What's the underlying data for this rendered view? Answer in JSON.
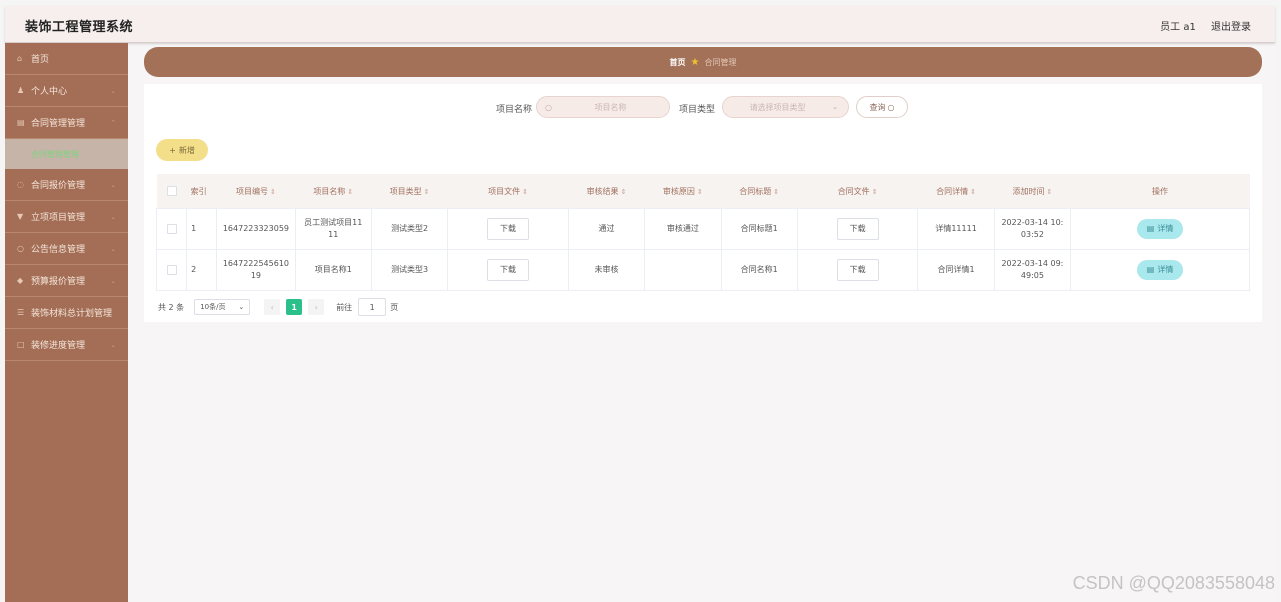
{
  "header": {
    "title": "装饰工程管理系统",
    "user": "员工 a1",
    "logout": "退出登录"
  },
  "sidebar": {
    "items": [
      {
        "icon": "home-icon",
        "label": "首页"
      },
      {
        "icon": "user-icon",
        "label": "个人中心"
      },
      {
        "icon": "folder-icon",
        "label": "合同管理管理"
      },
      {
        "icon": "money-icon",
        "label": "合同报价管理"
      },
      {
        "icon": "flag-icon",
        "label": "立项项目管理"
      },
      {
        "icon": "notice-icon",
        "label": "公告信息管理"
      },
      {
        "icon": "budget-icon",
        "label": "预算报价管理"
      },
      {
        "icon": "list-icon",
        "label": "装饰材料总计划管理"
      },
      {
        "icon": "progress-icon",
        "label": "装修进度管理"
      }
    ],
    "active_sub": "合同管理管理"
  },
  "breadcrumb": {
    "home": "首页",
    "current": "合同管理"
  },
  "search": {
    "name_label": "项目名称",
    "name_placeholder": "项目名称",
    "type_label": "项目类型",
    "type_placeholder": "请选择项目类型",
    "query_label": "查询"
  },
  "add_label": "新增",
  "table": {
    "headers": [
      "索引",
      "项目编号",
      "项目名称",
      "项目类型",
      "项目文件",
      "审核结果",
      "审核原因",
      "合同标题",
      "合同文件",
      "合同详情",
      "添加时间",
      "操作"
    ],
    "rows": [
      {
        "index": "1",
        "code": "1647223323059",
        "name": "员工测试项目11 11",
        "type": "测试类型2",
        "file": "下载",
        "result": "通过",
        "reason": "审核通过",
        "title": "合同标题1",
        "cfile": "下载",
        "detail": "详情11111",
        "time": "2022-03-14 10: 03:52",
        "action": "详情"
      },
      {
        "index": "2",
        "code": "1647222545610 19",
        "name": "项目名称1",
        "type": "测试类型3",
        "file": "下载",
        "result": "未审核",
        "reason": "",
        "title": "合同名称1",
        "cfile": "下载",
        "detail": "合同详情1",
        "time": "2022-03-14 09: 49:05",
        "action": "详情"
      }
    ]
  },
  "pagination": {
    "total": "共 2 条",
    "page_size": "10条/页",
    "current": "1",
    "goto": "前往",
    "goto_value": "1",
    "page_suffix": "页"
  },
  "watermark": "CSDN @QQ2083558048"
}
